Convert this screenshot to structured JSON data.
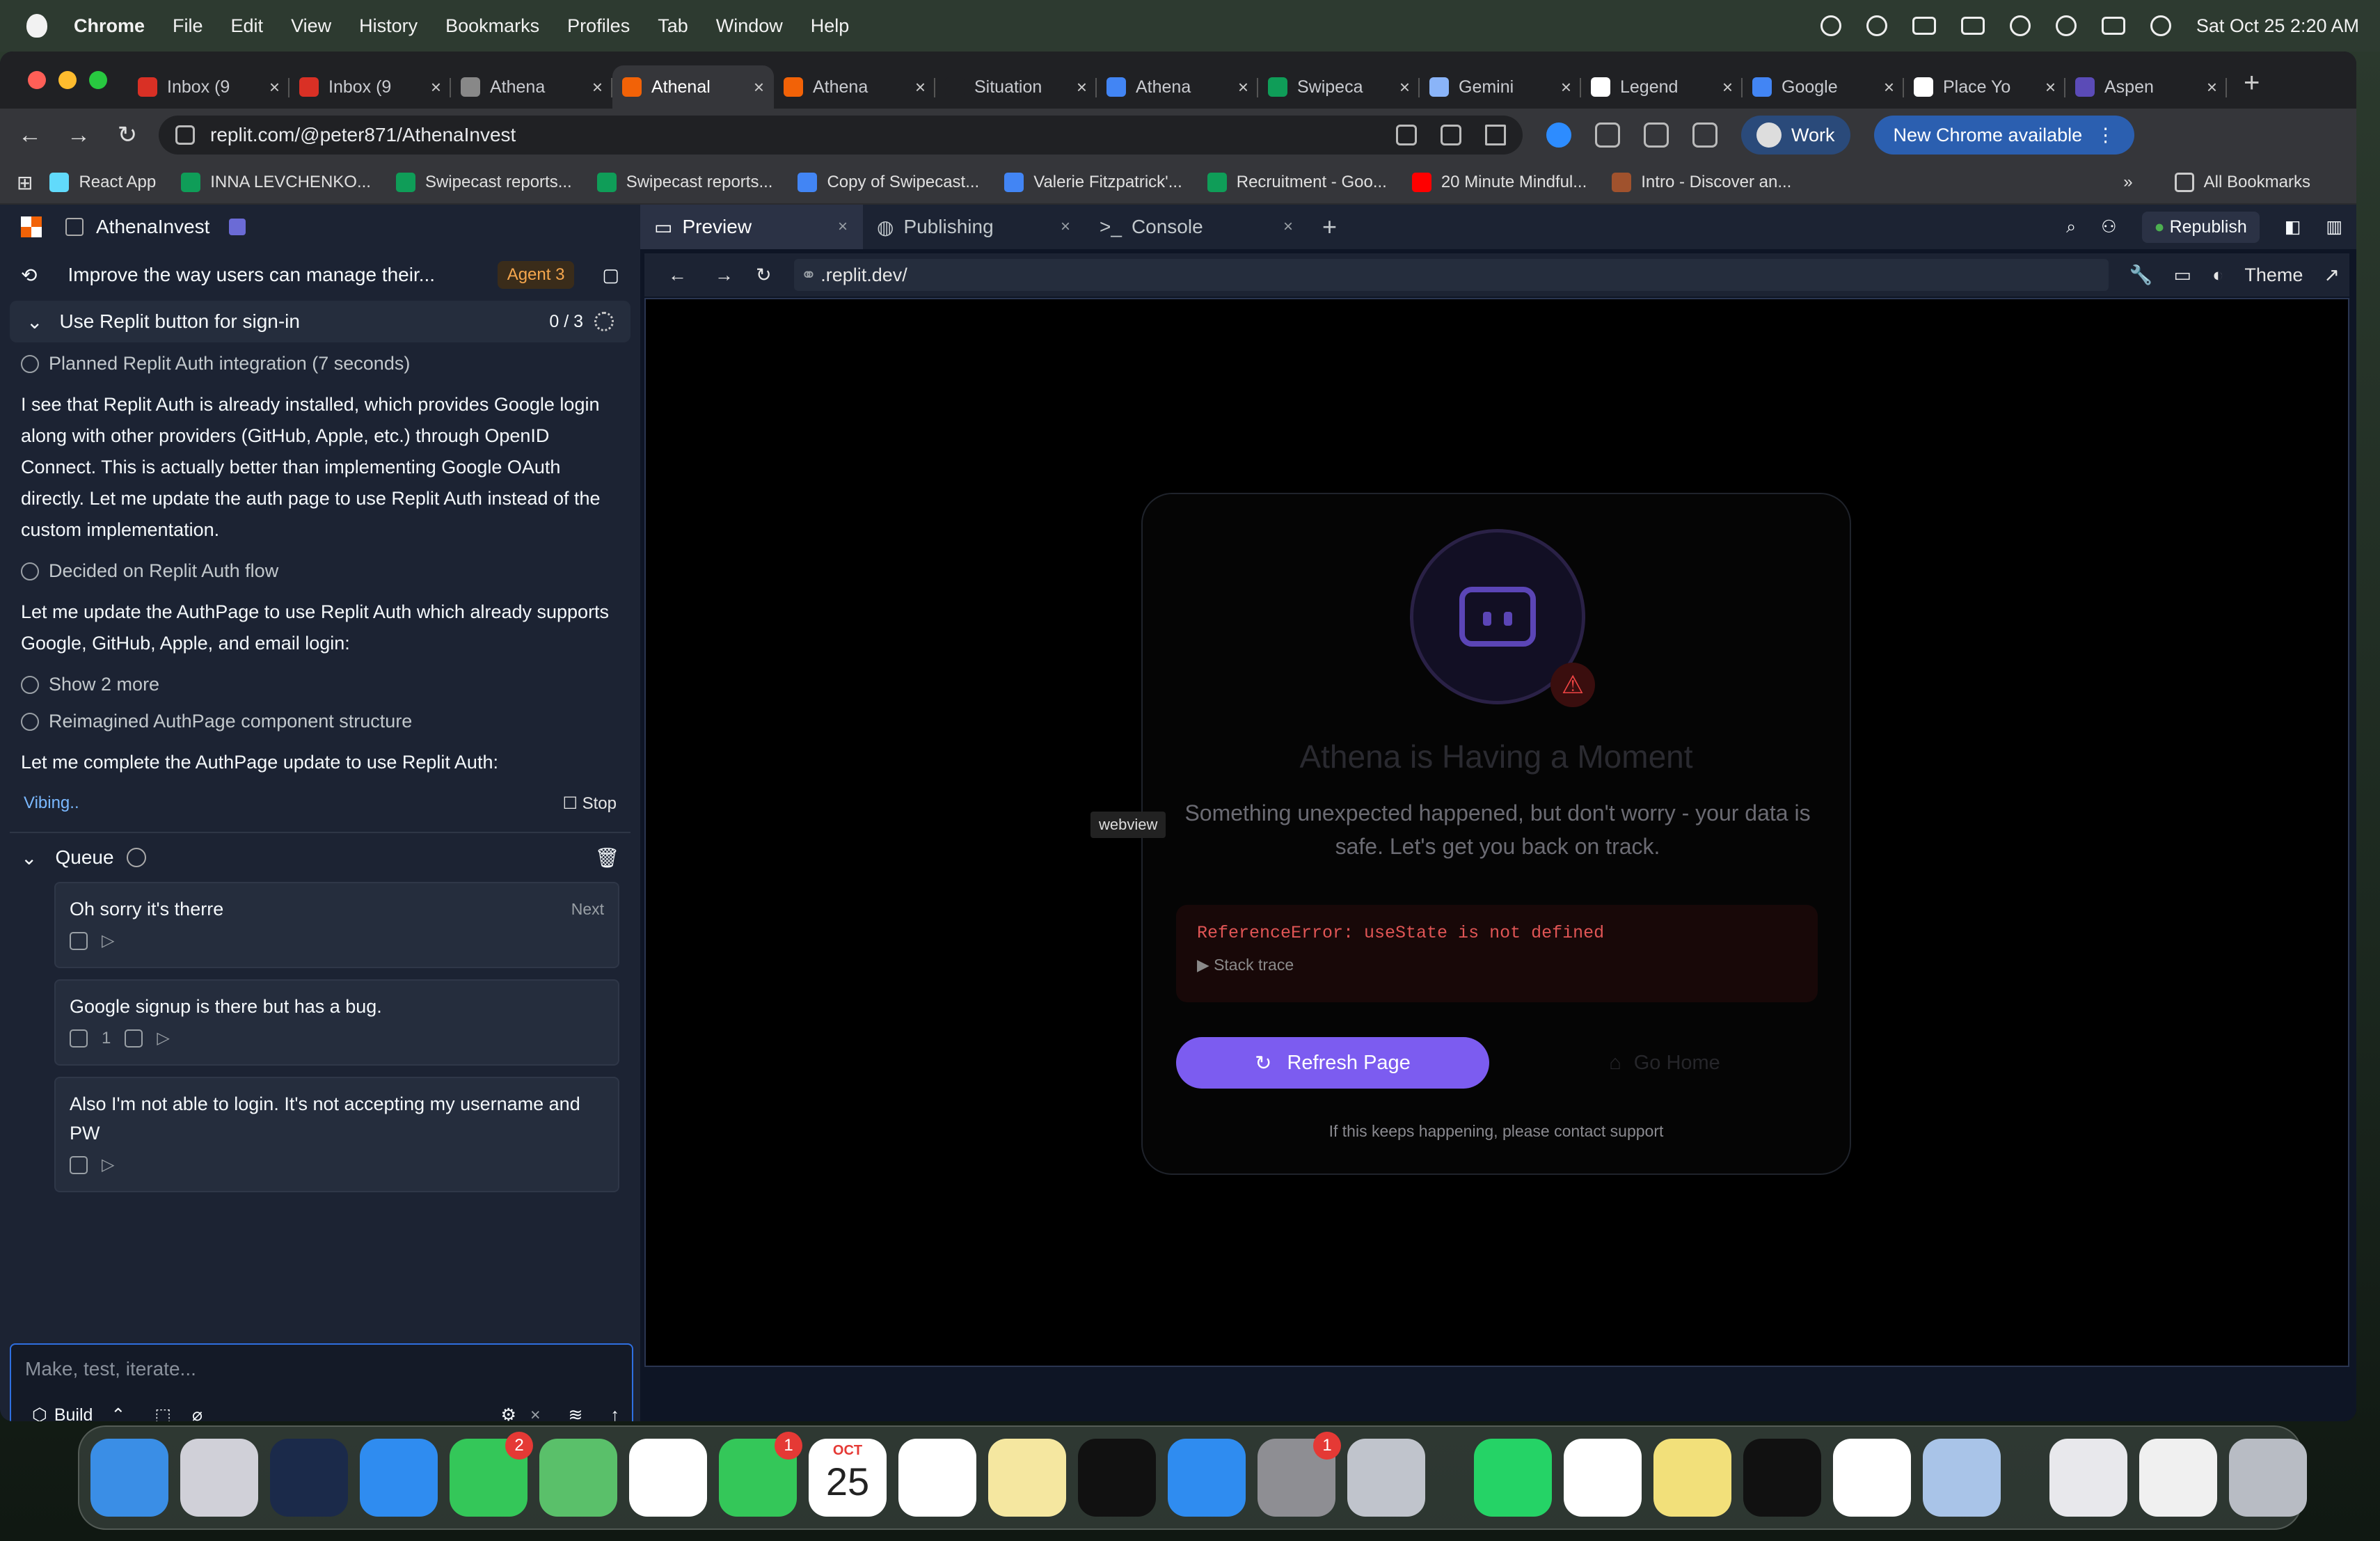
{
  "menubar": {
    "app": "Chrome",
    "items": [
      "File",
      "Edit",
      "View",
      "History",
      "Bookmarks",
      "Profiles",
      "Tab",
      "Window",
      "Help"
    ],
    "datetime": "Sat Oct 25  2:20 AM"
  },
  "tabs": [
    {
      "title": "Inbox (9",
      "color": "#d93025"
    },
    {
      "title": "Inbox (9",
      "color": "#d93025"
    },
    {
      "title": "Athena",
      "color": "#888888"
    },
    {
      "title": "Athenal",
      "color": "#f26207",
      "active": true
    },
    {
      "title": "Athena",
      "color": "#f26207"
    },
    {
      "title": "Situation",
      "color": "#202124"
    },
    {
      "title": "Athena",
      "color": "#4285f4"
    },
    {
      "title": "Swipeca",
      "color": "#0f9d58"
    },
    {
      "title": "Gemini",
      "color": "#8ab4f8"
    },
    {
      "title": "Legend",
      "color": "#ffffff"
    },
    {
      "title": "Google",
      "color": "#4285f4"
    },
    {
      "title": "Place Yo",
      "color": "#ffffff"
    },
    {
      "title": "Aspen",
      "color": "#5b4bb7"
    }
  ],
  "toolbar": {
    "url": "replit.com/@peter871/AthenaInvest",
    "profile": "Work",
    "update": "New Chrome available"
  },
  "bookmarks": {
    "items": [
      {
        "label": "React App",
        "color": "#61dafb"
      },
      {
        "label": "INNA LEVCHENKO...",
        "color": "#0f9d58"
      },
      {
        "label": "Swipecast reports...",
        "color": "#0f9d58"
      },
      {
        "label": "Swipecast reports...",
        "color": "#0f9d58"
      },
      {
        "label": "Copy of Swipecast...",
        "color": "#4285f4"
      },
      {
        "label": "Valerie Fitzpatrick'...",
        "color": "#4285f4"
      },
      {
        "label": "Recruitment - Goo...",
        "color": "#0f9d58"
      },
      {
        "label": "20 Minute Mindful...",
        "color": "#ff0000"
      },
      {
        "label": "Intro - Discover an...",
        "color": "#a0522d"
      }
    ],
    "more": "»",
    "all": "All Bookmarks"
  },
  "left": {
    "project": "AthenaInvest",
    "task": "Improve the way users can manage their...",
    "agent": "Agent 3",
    "step": {
      "label": "Use Replit button for sign-in",
      "progress": "0 / 3"
    },
    "messages": [
      {
        "kind": "thought",
        "text": "Planned Replit Auth integration (7 seconds)"
      },
      {
        "kind": "text",
        "text": "I see that Replit Auth is already installed, which provides Google login along with other providers (GitHub, Apple, etc.) through OpenID Connect. This is actually better than implementing Google OAuth directly. Let me update the auth page to use Replit Auth instead of the custom implementation."
      },
      {
        "kind": "thought",
        "text": "Decided on Replit Auth flow"
      },
      {
        "kind": "text",
        "text": "Let me update the AuthPage to use Replit Auth which already supports Google, GitHub, Apple, and email login:"
      },
      {
        "kind": "thought",
        "text": "Show 2 more"
      },
      {
        "kind": "thought",
        "text": "Reimagined AuthPage component structure"
      },
      {
        "kind": "text",
        "text": "Let me complete the AuthPage update to use Replit Auth:"
      }
    ],
    "status": "Vibing..",
    "stop": "Stop",
    "queue_title": "Queue",
    "queue": [
      {
        "text": "Oh sorry it's therre",
        "next": "Next",
        "attach": ""
      },
      {
        "text": "Google signup is there but has a bug.",
        "next": "",
        "attach": "1"
      },
      {
        "text": "Also I'm not able to login. It's not accepting my username and PW",
        "next": "",
        "attach": ""
      }
    ],
    "input_placeholder": "Make, test, iterate...",
    "mode": "Build"
  },
  "right": {
    "tabs": [
      "Preview",
      "Publishing",
      "Console"
    ],
    "republish": "Republish",
    "preview_url": ".replit.dev/",
    "theme": "Theme",
    "webview_tag": "webview",
    "error": {
      "title": "Athena is Having a Moment",
      "subtitle": "Something unexpected happened, but don't worry - your data is safe. Let's get you back on track.",
      "message": "ReferenceError: useState is not defined",
      "stack": "▶ Stack trace",
      "refresh": "Refresh Page",
      "home": "Go Home",
      "support": "If this keeps happening, please contact support"
    }
  },
  "dock": {
    "apps": [
      {
        "name": "Finder",
        "color": "#3a8ee6"
      },
      {
        "name": "Launchpad",
        "color": "#d0d0d8"
      },
      {
        "name": "Spark",
        "color": "#1b2a4a"
      },
      {
        "name": "Safari",
        "color": "#2f8cf0"
      },
      {
        "name": "Messages",
        "color": "#34c759",
        "badge": "2"
      },
      {
        "name": "Maps",
        "color": "#5ac06a"
      },
      {
        "name": "Photos",
        "color": "#ffffff"
      },
      {
        "name": "FaceTime",
        "color": "#34c759",
        "badge": "1"
      },
      {
        "name": "Calendar",
        "color": "#ffffff",
        "cal_month": "OCT",
        "cal_day": "25"
      },
      {
        "name": "Reminders",
        "color": "#ffffff"
      },
      {
        "name": "Notes",
        "color": "#f5e7a0"
      },
      {
        "name": "TV",
        "color": "#111111"
      },
      {
        "name": "App Store",
        "color": "#2f8cf0"
      },
      {
        "name": "System Settings",
        "color": "#8e8e93",
        "badge": "1"
      },
      {
        "name": "iPhone Mirroring",
        "color": "#c0c4cc"
      },
      {
        "name": "WhatsApp",
        "color": "#25d366"
      },
      {
        "name": "Slack",
        "color": "#ffffff"
      },
      {
        "name": "Stickies",
        "color": "#f2e07a"
      },
      {
        "name": "Spotify",
        "color": "#111111"
      },
      {
        "name": "Chrome",
        "color": "#ffffff"
      },
      {
        "name": "Preview",
        "color": "#a9c4e8"
      },
      {
        "name": "Document",
        "color": "#e8e8ec"
      },
      {
        "name": "Screenshot",
        "color": "#f0f0f0"
      },
      {
        "name": "Trash",
        "color": "#b8bcc4"
      }
    ]
  }
}
